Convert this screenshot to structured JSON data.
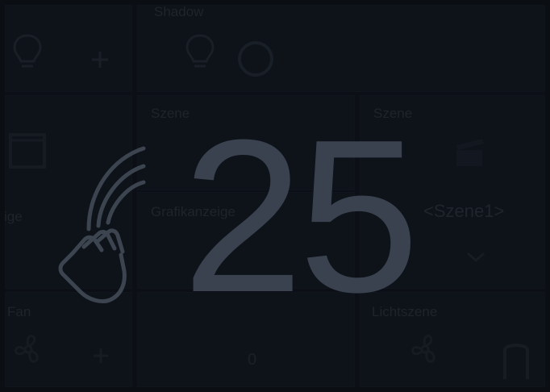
{
  "tiles": {
    "top_center_title": "Shadow",
    "scene_tile_center": {
      "title": "Szene"
    },
    "scene_tile_right": {
      "title": "Szene",
      "scene_name": "<Szene1>"
    },
    "left_middle_label": "ige",
    "center_middle_label": "Grafikanzeige",
    "left_bottom_label": "Fan",
    "right_bottom_label": "Lichtszene",
    "center_bottom_value": "0"
  },
  "overlay": {
    "big_value": "25",
    "gesture_icon": "proximity-hand-icon"
  },
  "colors": {
    "background": "#0e1219",
    "overlay_number": "#3a4250",
    "icon_stroke": "#3c444f"
  }
}
